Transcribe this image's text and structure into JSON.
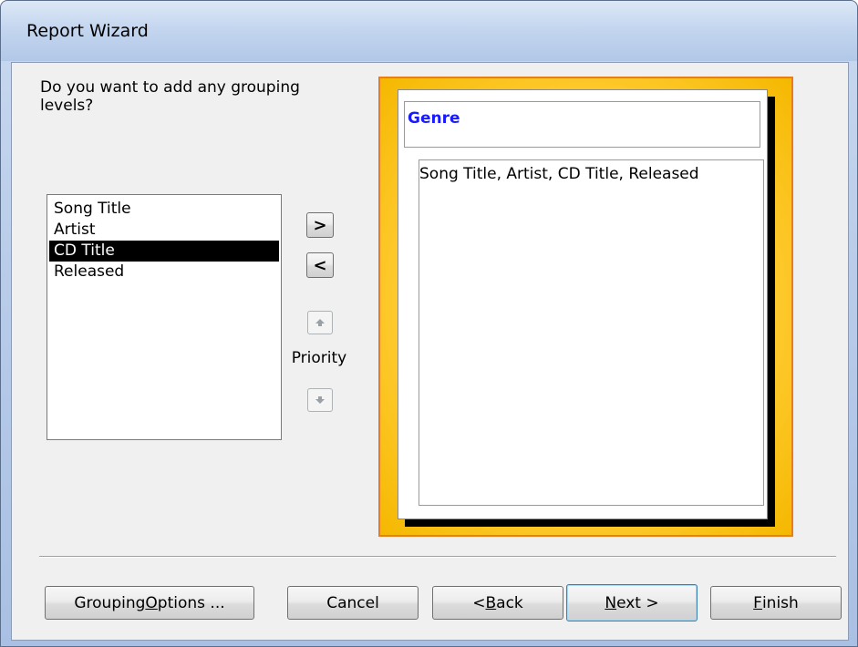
{
  "window": {
    "title": "Report Wizard"
  },
  "question": "Do you want to add any grouping levels?",
  "fields": [
    "Song Title",
    "Artist",
    "CD Title",
    "Released"
  ],
  "selected_field": "CD Title",
  "move_buttons": {
    "add": ">",
    "remove": "<"
  },
  "priority": {
    "label": "Priority",
    "up_icon": "up-arrow-icon",
    "down_icon": "down-arrow-icon"
  },
  "preview": {
    "group_header": "Genre",
    "detail_fields": "Song Title, Artist, CD Title, Released",
    "group_header_color": "#1a1aff"
  },
  "footer": {
    "grouping_options_pre": "Grouping ",
    "grouping_options_key": "O",
    "grouping_options_post": "ptions ...",
    "cancel": "Cancel",
    "back_pre": "< ",
    "back_key": "B",
    "back_post": "ack",
    "next_key": "N",
    "next_post": "ext >",
    "finish_key": "F",
    "finish_post": "inish"
  },
  "colors": {
    "selection_bg": "#000000",
    "preview_border": "#e87d1e",
    "preview_fill": "#ffcc33"
  }
}
